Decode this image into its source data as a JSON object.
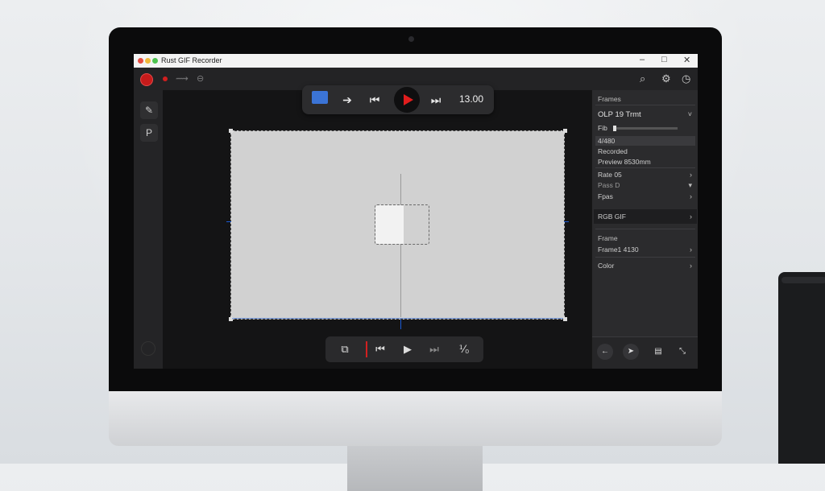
{
  "app": {
    "title": "Rust GIF Recorder",
    "window_controls": {
      "minimize": "–",
      "maximize": "□",
      "close": "✕"
    }
  },
  "toolbar": {
    "record_icon": "record-icon",
    "icons": [
      "record-small-icon",
      "pin-icon",
      "settings-icon",
      "search-icon",
      "gear-icon",
      "clock-icon"
    ]
  },
  "left_tools": [
    {
      "icon": "pen-icon",
      "glyph": "✎"
    },
    {
      "icon": "text-tool-icon",
      "glyph": "P"
    }
  ],
  "floating_controls": {
    "time": "13.00"
  },
  "panel": {
    "header": "Frames",
    "clip_title": "OLP 19 Trmt",
    "slider_label": "Fib",
    "slider_value": 0.02,
    "rows": [
      {
        "label": "4/480",
        "highlight": true
      },
      {
        "label": "Recorded"
      },
      {
        "label": "Preview 8530mm"
      },
      {
        "label": "Rate 05",
        "arrow": "›"
      },
      {
        "label": "Pass D",
        "arrow": "▾"
      },
      {
        "label": "Fpas",
        "arrow": "›"
      }
    ],
    "export_label": "RGB GIF",
    "section2_header": "Frame",
    "frame_row": "Frame1 4130",
    "color_row": "Color",
    "bottom_buttons": [
      "back-icon",
      "forward-icon",
      "film-icon",
      "crop-icon"
    ]
  },
  "bottom_controls": {
    "speed_label": "⅟₀"
  },
  "colors": {
    "accent_red": "#e11d1d",
    "guide_blue": "#1b5bd6",
    "canvas": "#d1d1d1"
  }
}
